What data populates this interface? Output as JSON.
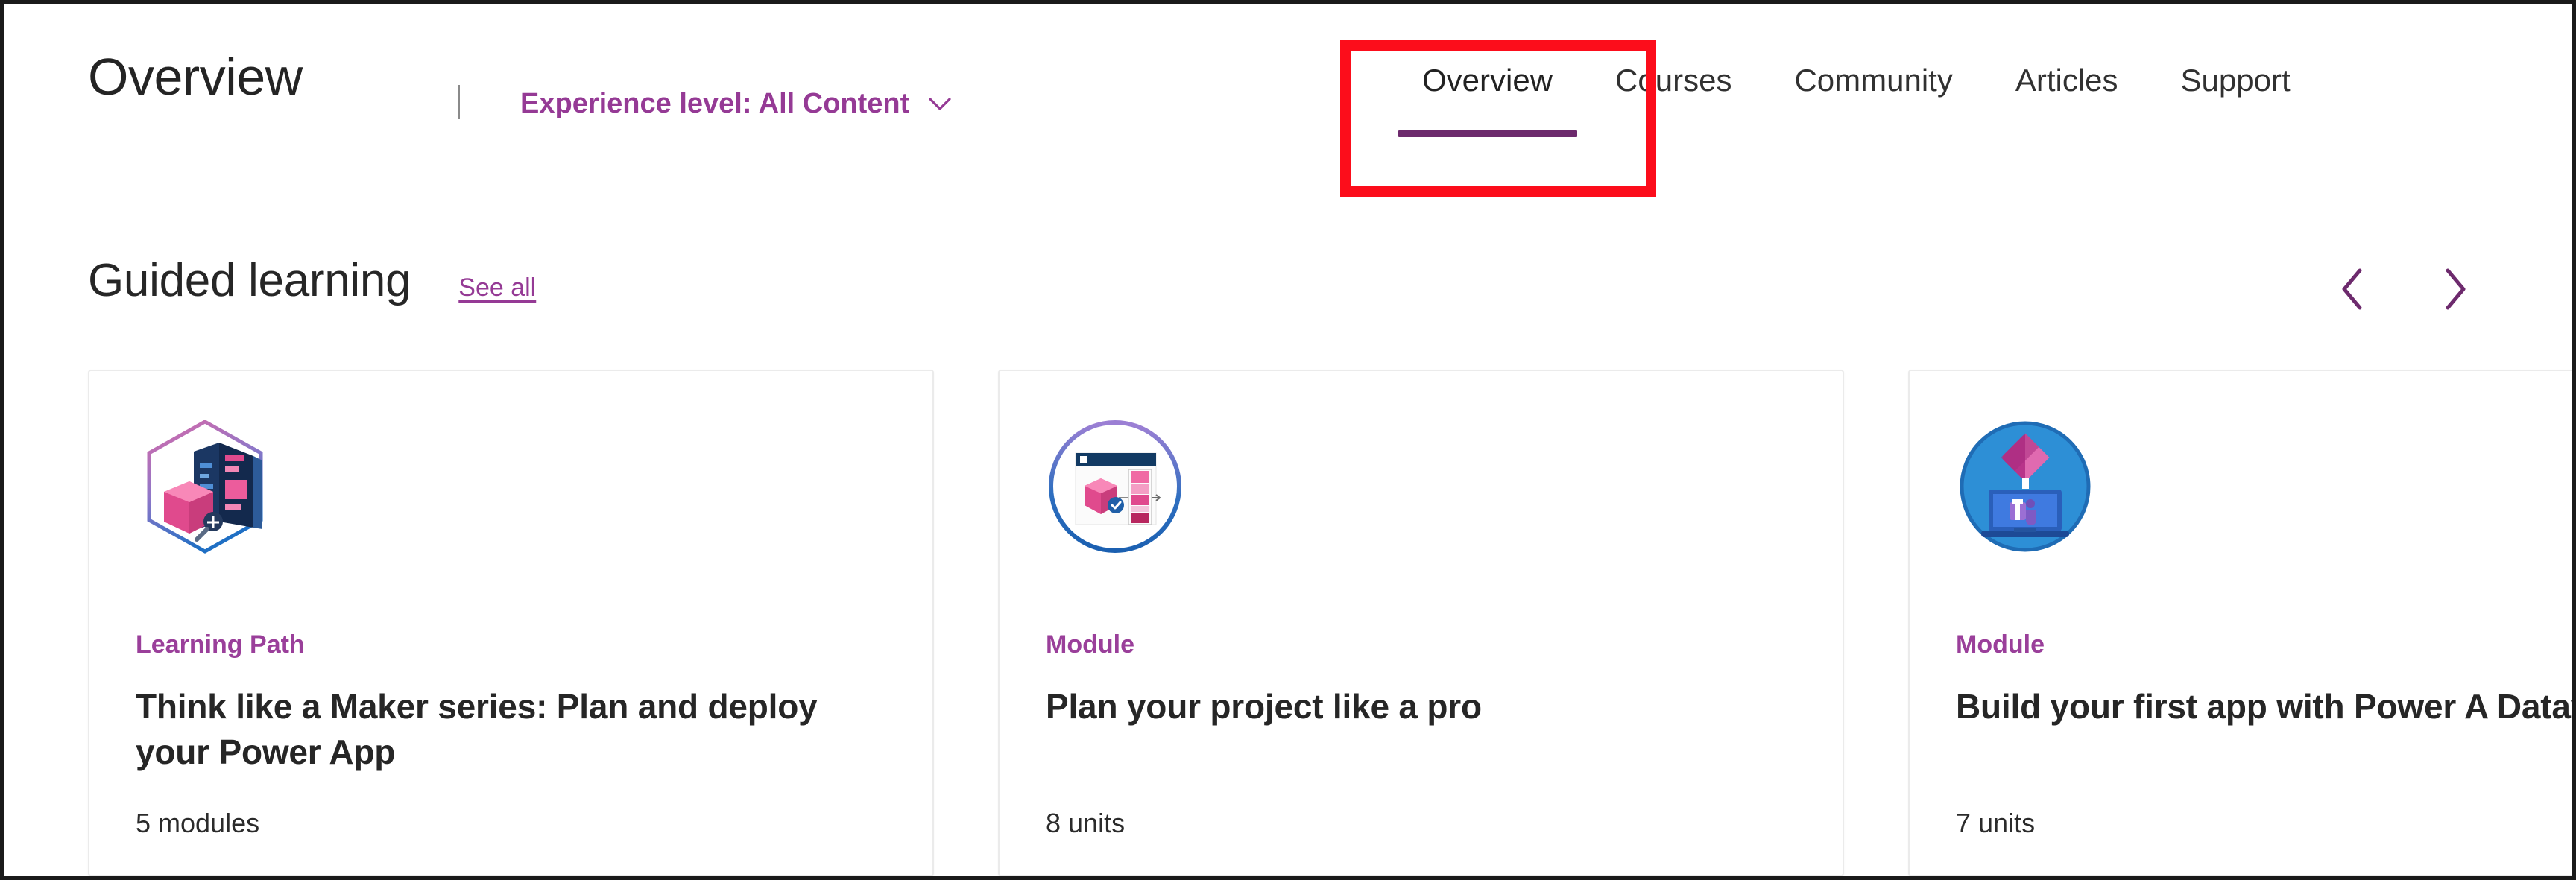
{
  "header": {
    "page_title": "Overview",
    "divider": "|",
    "experience_filter": {
      "label": "Experience level: All Content",
      "chevron_icon": "chevron-down-icon"
    }
  },
  "nav": {
    "tabs": [
      {
        "label": "Overview",
        "active": true
      },
      {
        "label": "Courses",
        "active": false
      },
      {
        "label": "Community",
        "active": false
      },
      {
        "label": "Articles",
        "active": false
      },
      {
        "label": "Support",
        "active": false
      }
    ]
  },
  "annotation": {
    "color": "#fc0d1b",
    "target": "Overview"
  },
  "section": {
    "title": "Guided learning",
    "see_all_label": "See all",
    "prev_icon": "chevron-left-icon",
    "next_icon": "chevron-right-icon"
  },
  "cards": [
    {
      "kicker": "Learning Path",
      "title": "Think like a Maker series: Plan and deploy your Power App",
      "meta": "5 modules",
      "icon_name": "learning-path-hexagon-icon"
    },
    {
      "kicker": "Module",
      "title": "Plan your project like a pro",
      "meta": "8 units",
      "icon_name": "module-circle-plan-icon"
    },
    {
      "kicker": "Module",
      "title": "Build your first app with Power A Dataverse for Teams",
      "meta": "7 units",
      "icon_name": "module-circle-teams-icon"
    }
  ],
  "colors": {
    "accent_purple": "#953a95",
    "active_underline": "#6d2a6d",
    "text_primary": "#262626",
    "annotation_red": "#fc0d1b",
    "card_border": "#ebebeb",
    "icon_blue": "#2a8ad4",
    "icon_pink": "#ec5c9c"
  }
}
